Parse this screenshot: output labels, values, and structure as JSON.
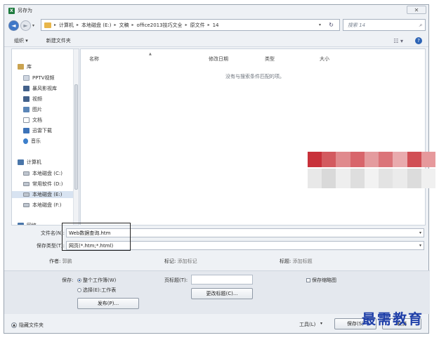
{
  "window": {
    "title": "另存为",
    "app_icon_letter": "X",
    "close_glyph": "✕"
  },
  "nav": {
    "back_glyph": "◄",
    "forward_glyph": "►",
    "breadcrumbs": [
      "计算机",
      "本地磁盘 (E:)",
      "文稿",
      "office2013技巧文全",
      "原文件",
      "14"
    ],
    "search_placeholder": "搜索 14"
  },
  "toolbar": {
    "organize": "组织 ▾",
    "new_folder": "新建文件夹",
    "view_glyph": "☷ ▾",
    "help_glyph": "?"
  },
  "sidebar": {
    "library": "库",
    "library_items": [
      "PPTV视频",
      "暴风影视库",
      "视频",
      "图片",
      "文档",
      "迅雷下载",
      "音乐"
    ],
    "computer": "计算机",
    "drives": [
      "本地磁盘 (C:)",
      "常用软件 (D:)",
      "本地磁盘 (E:)",
      "本地磁盘 (F:)"
    ],
    "network": "网络"
  },
  "file_list": {
    "columns": [
      "名称",
      "修改日期",
      "类型",
      "大小"
    ],
    "empty_message": "没有与搜索条件匹配的项。"
  },
  "form": {
    "filename_label": "文件名(N):",
    "filename_value": "Web数据查询.htm",
    "filetype_label": "保存类型(T):",
    "filetype_value": "网页(*.htm;*.html)"
  },
  "meta": {
    "author_label": "作者:",
    "author_value": "郭鹏",
    "tags_label": "标记:",
    "tags_value": "添加标记",
    "title_label": "标题:",
    "title_value": "添加标题"
  },
  "options": {
    "save_label": "保存:",
    "radio_whole": "整个工作簿(W)",
    "radio_selection": "选择(E):工作表",
    "publish_button": "发布(P)...",
    "page_title_label": "页标题(T):",
    "change_title_button": "更改标题(C)...",
    "save_thumbnail": "保存缩略图"
  },
  "footer": {
    "hide_folders": "隐藏文件夹",
    "tools": "工具(L)",
    "save_button": "保存(S)",
    "cancel_button": "取消"
  },
  "watermark": "最需教育",
  "colors": {
    "red_strip": [
      "#c8313a",
      "#d35a5f",
      "#e08a8d",
      "#d8656b",
      "#e49b9e",
      "#db7479",
      "#e9aaad",
      "#d14f55",
      "#e6999c"
    ],
    "grey_strip": [
      "#e8e8e8",
      "#d9d9d9",
      "#eeeeee",
      "#dedede",
      "#f2f2f2",
      "#e3e3e3",
      "#ebebeb",
      "#dcdcdc",
      "#f0f0f0"
    ]
  }
}
